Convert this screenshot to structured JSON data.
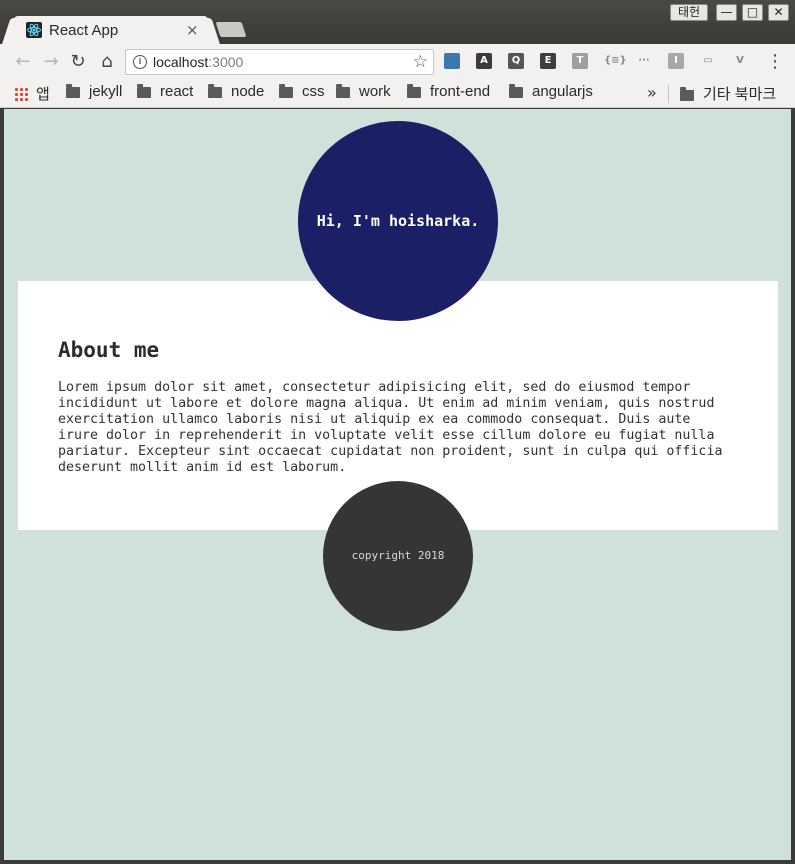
{
  "window": {
    "ime_label": "태헌",
    "min_glyph": "—",
    "max_glyph": "□",
    "close_glyph": "✕"
  },
  "tab": {
    "title": "React App",
    "close_glyph": "×"
  },
  "nav": {
    "back": "←",
    "forward": "→",
    "reload": "↻",
    "home": "⌂"
  },
  "address": {
    "host": "localhost",
    "port": ":3000",
    "info_glyph": "i",
    "star_glyph": "☆"
  },
  "extensions": [
    {
      "name": "python-icon",
      "label": "",
      "color": "#3c78aa"
    },
    {
      "name": "translate-icon",
      "label": "A",
      "color": "#3b3b3b"
    },
    {
      "name": "lightbulb-icon",
      "label": "Q",
      "color": "#555555"
    },
    {
      "name": "evernote-icon",
      "label": "E",
      "color": "#3d3d3d"
    },
    {
      "name": "text-icon",
      "label": "T",
      "color": "#9e9e9e"
    },
    {
      "name": "json-icon",
      "label": "{≡}",
      "color": "#f2f1f0"
    },
    {
      "name": "dots-icon",
      "label": "···",
      "color": "#f2f1f0"
    },
    {
      "name": "i-icon",
      "label": "I",
      "color": "#a8a8a8"
    },
    {
      "name": "window-icon",
      "label": "▭",
      "color": "#f2f1f0"
    },
    {
      "name": "vue-icon",
      "label": "V",
      "color": "#f2f1f0"
    }
  ],
  "menu_glyph": "⋮",
  "bookmarks": {
    "apps_label": "앱",
    "items": [
      "jekyll",
      "react",
      "node",
      "css",
      "work",
      "front-end",
      "angularjs"
    ],
    "overflow_glyph": "»",
    "other_label": "기타 북마크"
  },
  "page": {
    "hero_text": "Hi, I'm hoisharka.",
    "about_title": "About me",
    "about_text": "Lorem ipsum dolor sit amet, consectetur adipisicing elit, sed do eiusmod tempor incididunt ut labore et dolore magna aliqua. Ut enim ad minim veniam, quis nostrud exercitation ullamco laboris nisi ut aliquip ex ea commodo consequat. Duis aute irure dolor in reprehenderit in voluptate velit esse cillum dolore eu fugiat nulla pariatur. Excepteur sint occaecat cupidatat non proident, sunt in culpa qui officia deserunt mollit anim id est laborum.",
    "footer_text": "copyright 2018"
  },
  "colors": {
    "page_bg": "#cfe1da",
    "hero_circle": "#1b1f66",
    "footer_circle": "#353535",
    "card_bg": "#ffffff"
  }
}
